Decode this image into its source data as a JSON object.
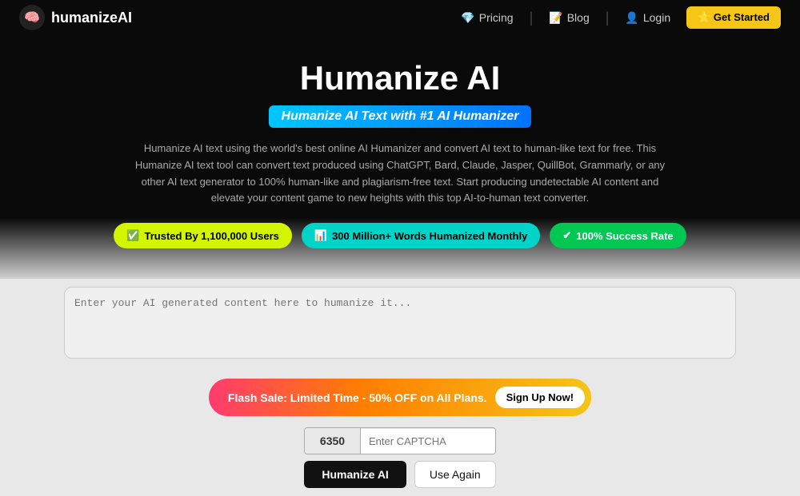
{
  "nav": {
    "logo_text": "humanizeAI",
    "logo_icon": "🧠",
    "links": [
      {
        "label": "Pricing",
        "icon": "💎"
      },
      {
        "label": "Blog",
        "icon": "📝"
      },
      {
        "label": "Login",
        "icon": "👤"
      }
    ],
    "cta_label": "⭐ Get Started"
  },
  "hero": {
    "title": "Humanize AI",
    "subtitle": "Humanize AI Text with #1 AI Humanizer",
    "description": "Humanize AI text using the world's best online AI Humanizer and convert AI text to human-like text for free. This Humanize AI text tool can convert text produced using ChatGPT, Bard, Claude, Jasper, QuillBot, Grammarly, or any other AI text generator to 100% human-like and plagiarism-free text. Start producing undetectable AI content and elevate your content game to new heights with this top AI-to-human text converter."
  },
  "badges": [
    {
      "label": "Trusted By 1,100,000 Users",
      "icon": "✅",
      "style": "yellow"
    },
    {
      "label": "300 Million+ Words Humanized Monthly",
      "icon": "📊",
      "style": "cyan"
    },
    {
      "label": "100% Success Rate",
      "icon": "✔",
      "style": "green"
    }
  ],
  "textarea": {
    "placeholder": "Enter your AI generated content here to humanize it..."
  },
  "flash_sale": {
    "text": "Flash Sale: Limited Time - 50% OFF on All Plans.",
    "button_label": "Sign Up Now!"
  },
  "captcha": {
    "code": "6350",
    "placeholder": "Enter CAPTCHA"
  },
  "buttons": {
    "humanize_label": "Humanize AI",
    "use_again_label": "Use Again"
  }
}
